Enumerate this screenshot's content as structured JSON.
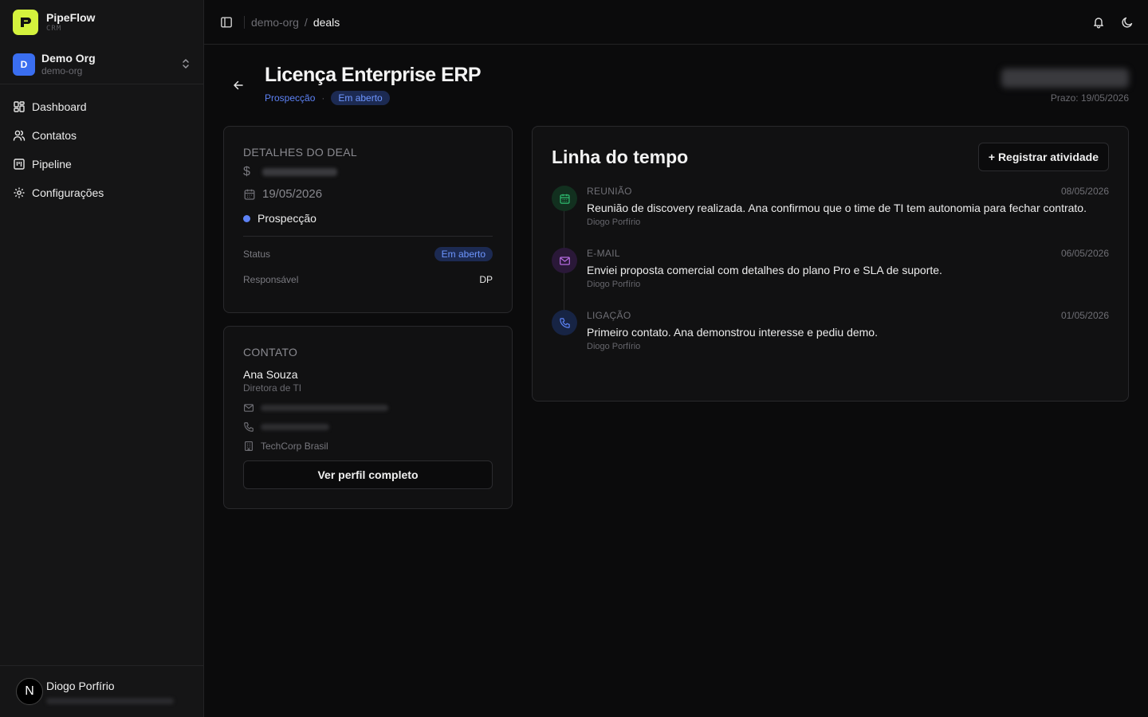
{
  "brand": {
    "name": "PipeFlow",
    "sub": "CRM"
  },
  "org": {
    "initial": "D",
    "name": "Demo Org",
    "slug": "demo-org"
  },
  "nav": [
    {
      "label": "Dashboard",
      "icon": "dashboard-icon"
    },
    {
      "label": "Contatos",
      "icon": "users-icon"
    },
    {
      "label": "Pipeline",
      "icon": "kanban-icon"
    },
    {
      "label": "Configurações",
      "icon": "gear-icon"
    }
  ],
  "user": {
    "initial": "N",
    "name": "Diogo Porfírio"
  },
  "breadcrumb": {
    "org": "demo-org",
    "separator": "/",
    "current": "deals"
  },
  "deal": {
    "title": "Licença Enterprise ERP",
    "stage": "Prospecção",
    "status": "Em aberto",
    "deadline": "Prazo: 19/05/2026"
  },
  "details": {
    "title": "DETALHES DO DEAL",
    "currency_symbol": "$",
    "date": "19/05/2026",
    "stage": "Prospecção",
    "status_label": "Status",
    "status_value": "Em aberto",
    "owner_label": "Responsável",
    "owner_value": "DP"
  },
  "contact": {
    "title": "CONTATO",
    "name": "Ana Souza",
    "role": "Diretora de TI",
    "company": "TechCorp Brasil",
    "button": "Ver perfil completo"
  },
  "timeline": {
    "title": "Linha do tempo",
    "button": "+ Registrar atividade",
    "items": [
      {
        "type": "REUNIÃO",
        "date": "08/05/2026",
        "text": "Reunião de discovery realizada. Ana confirmou que o time de TI tem autonomia para fechar contrato.",
        "author": "Diogo Porfírio",
        "icon": "calendar-icon",
        "color": "#2fbf71"
      },
      {
        "type": "E-MAIL",
        "date": "06/05/2026",
        "text": "Enviei proposta comercial com detalhes do plano Pro e SLA de suporte.",
        "author": "Diogo Porfírio",
        "icon": "mail-icon",
        "color": "#b56ce0"
      },
      {
        "type": "LIGAÇÃO",
        "date": "01/05/2026",
        "text": "Primeiro contato. Ana demonstrou interesse e pediu demo.",
        "author": "Diogo Porfírio",
        "icon": "phone-icon",
        "color": "#5d82f5"
      }
    ]
  }
}
